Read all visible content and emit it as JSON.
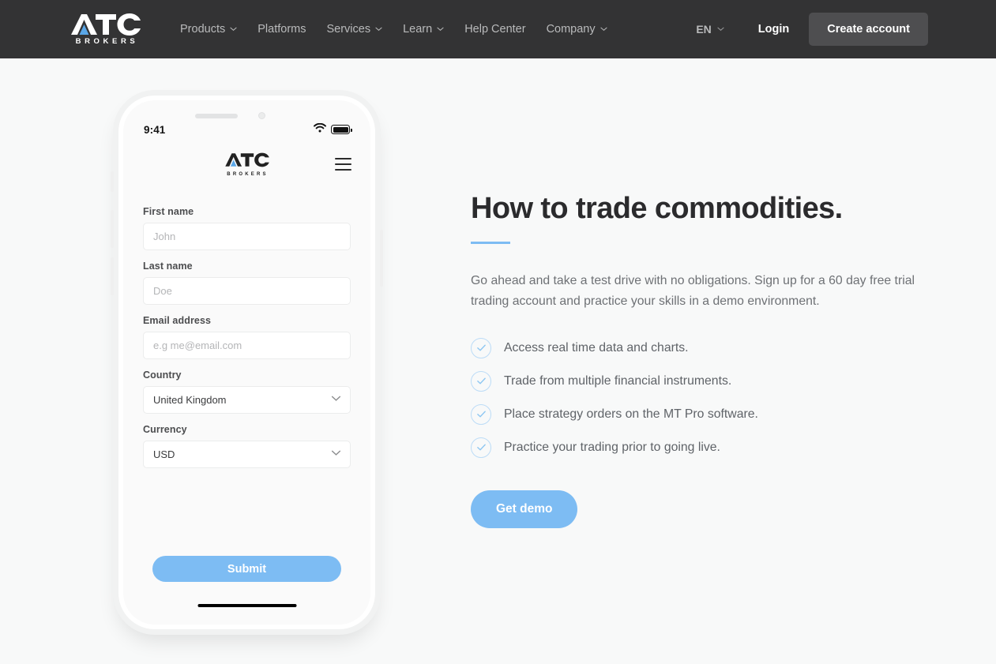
{
  "header": {
    "logo": {
      "name": "ATC",
      "subtitle": "BROKERS",
      "accent_color": "#5aa7e8"
    },
    "nav": [
      {
        "label": "Products",
        "has_dropdown": true
      },
      {
        "label": "Platforms",
        "has_dropdown": false
      },
      {
        "label": "Services",
        "has_dropdown": true
      },
      {
        "label": "Learn",
        "has_dropdown": true
      },
      {
        "label": "Help Center",
        "has_dropdown": false
      },
      {
        "label": "Company",
        "has_dropdown": true
      }
    ],
    "language": "EN",
    "login_label": "Login",
    "create_account_label": "Create account",
    "background_color": "#333334"
  },
  "phone": {
    "status_bar": {
      "time": "9:41",
      "wifi_icon": "wifi-icon",
      "battery_icon": "battery-icon"
    },
    "app_logo": {
      "name": "ATC",
      "subtitle": "BROKERS"
    },
    "menu_icon": "hamburger-menu-icon",
    "form": {
      "fields": [
        {
          "label": "First name",
          "placeholder": "John",
          "value": "",
          "type": "text"
        },
        {
          "label": "Last name",
          "placeholder": "Doe",
          "value": "",
          "type": "text"
        },
        {
          "label": "Email address",
          "placeholder": "e.g me@email.com",
          "value": "",
          "type": "email"
        }
      ],
      "selects": [
        {
          "label": "Country",
          "value": "United Kingdom"
        },
        {
          "label": "Currency",
          "value": "USD"
        }
      ],
      "submit_label": "Submit"
    }
  },
  "main": {
    "headline": "How to trade commodities.",
    "lede": "Go ahead and take a test drive with no obligations. Sign up for a 60 day free trial trading account and practice your skills in a demo environment.",
    "checklist": [
      "Access real time data and charts.",
      "Trade from multiple financial instruments.",
      "Place strategy orders on the MT Pro software.",
      "Practice your trading prior to going live."
    ],
    "cta_label": "Get demo",
    "accent_color": "#7dbcf3"
  }
}
